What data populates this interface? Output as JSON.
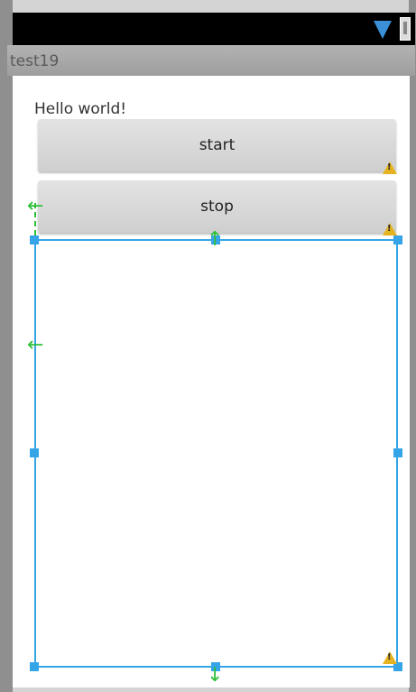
{
  "status_bar": {
    "icons": [
      "wifi-icon",
      "battery-icon"
    ]
  },
  "title_bar": {
    "title": "test19"
  },
  "content": {
    "hello_text": "Hello world!",
    "start_label": "start",
    "stop_label": "stop"
  },
  "colors": {
    "selection": "#35a5e8",
    "guide": "#2fbf3a",
    "warning": "#e6b320"
  }
}
